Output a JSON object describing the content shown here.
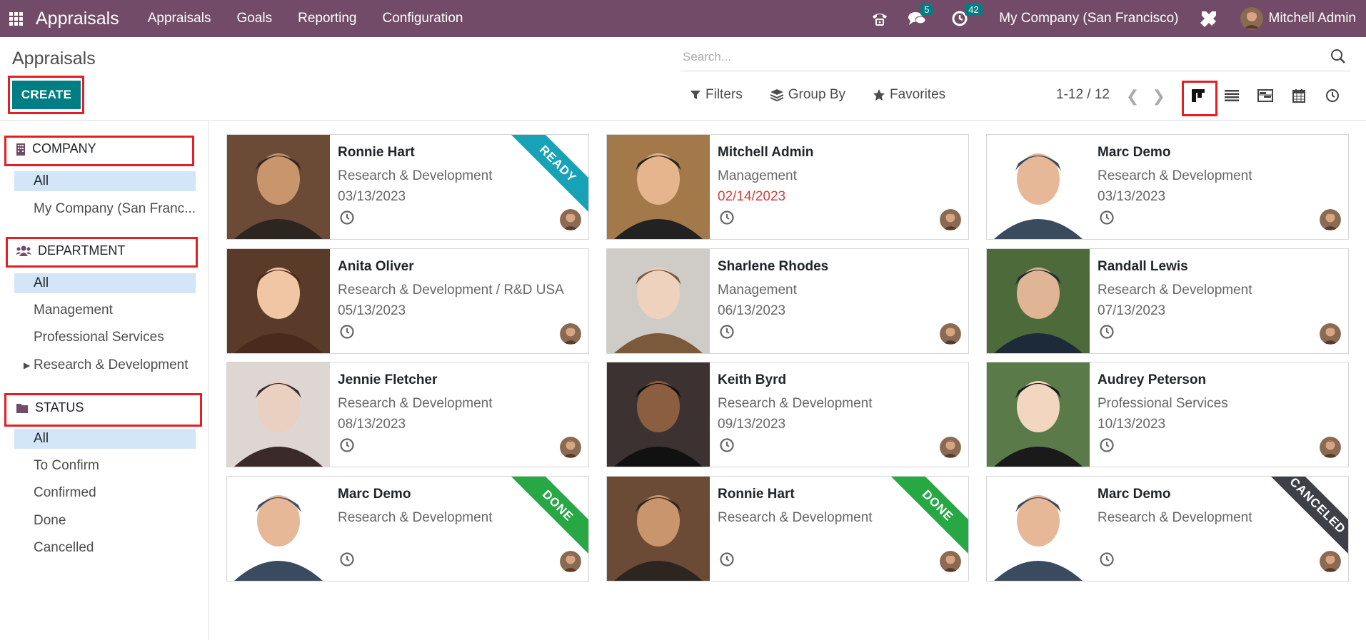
{
  "navbar": {
    "app_title": "Appraisals",
    "menu": [
      "Appraisals",
      "Goals",
      "Reporting",
      "Configuration"
    ],
    "messages_count": "5",
    "activities_count": "42",
    "company": "My Company (San Francisco)",
    "user": "Mitchell Admin",
    "bg_color": "#714b67"
  },
  "control_panel": {
    "breadcrumb": "Appraisals",
    "create_label": "CREATE",
    "search_placeholder": "Search...",
    "filters_label": "Filters",
    "groupby_label": "Group By",
    "favorites_label": "Favorites",
    "pager": "1-12 / 12",
    "views": [
      "kanban-icon",
      "list-icon",
      "gantt-icon",
      "calendar-icon",
      "activity-icon"
    ],
    "active_view": "kanban"
  },
  "side_panel": {
    "company": {
      "title": "COMPANY",
      "items": [
        "All",
        "My Company (San Franc..."
      ],
      "selected": "All"
    },
    "department": {
      "title": "DEPARTMENT",
      "items": [
        "All",
        "Management",
        "Professional Services",
        "Research & Development"
      ],
      "selected": "All"
    },
    "status": {
      "title": "STATUS",
      "items": [
        "All",
        "To Confirm",
        "Confirmed",
        "Done",
        "Cancelled"
      ],
      "selected": "All"
    }
  },
  "cards": [
    {
      "name": "Ronnie Hart",
      "department": "Research & Development",
      "date": "03/13/2023",
      "ribbon": "READY",
      "ribbon_color": "#17a2b8"
    },
    {
      "name": "Mitchell Admin",
      "department": "Management",
      "date": "02/14/2023",
      "overdue": true
    },
    {
      "name": "Marc Demo",
      "department": "Research & Development",
      "date": "03/13/2023"
    },
    {
      "name": "Anita Oliver",
      "department": "Research & Development / R&D USA",
      "date": "05/13/2023"
    },
    {
      "name": "Sharlene Rhodes",
      "department": "Management",
      "date": "06/13/2023"
    },
    {
      "name": "Randall Lewis",
      "department": "Research & Development",
      "date": "07/13/2023"
    },
    {
      "name": "Jennie Fletcher",
      "department": "Research & Development",
      "date": "08/13/2023"
    },
    {
      "name": "Keith Byrd",
      "department": "Research & Development",
      "date": "09/13/2023"
    },
    {
      "name": "Audrey Peterson",
      "department": "Professional Services",
      "date": "10/13/2023"
    },
    {
      "name": "Marc Demo",
      "department": "Research & Development",
      "date": "",
      "ribbon": "DONE",
      "ribbon_color": "#28a745"
    },
    {
      "name": "Ronnie Hart",
      "department": "Research & Development",
      "date": "",
      "ribbon": "DONE",
      "ribbon_color": "#28a745"
    },
    {
      "name": "Marc Demo",
      "department": "Research & Development",
      "date": "",
      "ribbon": "CANCELED",
      "ribbon_color": "#3d4047"
    }
  ]
}
